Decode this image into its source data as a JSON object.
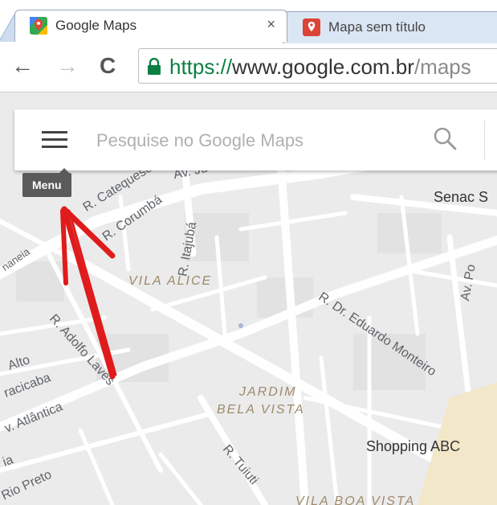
{
  "tabs": [
    {
      "title": "Google Maps",
      "close": "×"
    },
    {
      "title": "Mapa sem título"
    }
  ],
  "toolbar": {
    "back": "←",
    "forward": "→",
    "reload": "C",
    "url_scheme": "https://",
    "url_host": "www.google.com.br",
    "url_path": "/maps"
  },
  "search": {
    "placeholder": "Pesquise no Google Maps",
    "tooltip": "Menu"
  },
  "map": {
    "streets": {
      "catequese": "R. Catequese",
      "avju": "Av. Ju",
      "corumba": "R. Corumbá",
      "itajuba": "R. Itajubá",
      "eduardo": "R. Dr. Eduardo Monteiro",
      "adolfo": "R. Adolfo Laves",
      "alto": "Alto",
      "racicaba": "racicaba",
      "atlantica": "v. Atlântica",
      "tuiuti": "R. Tuiuti",
      "rioPreto": "Rio Preto",
      "ia": "ia",
      "naneia": "naneia",
      "avpo": "Av. Po"
    },
    "districts": {
      "vilaAlice": "VILA ALICE",
      "jardimLine1": "JARDIM",
      "jardimLine2": "BELA VISTA",
      "vilaBoaVista": "VILA BOA VISTA"
    },
    "pois": {
      "senac": "Senac S",
      "shopping": "Shopping ABC"
    }
  },
  "colors": {
    "arrow": "#e01b1b",
    "road": "#ffffff",
    "land": "#ebebeb"
  },
  "icons": [
    "maps-favicon",
    "pin-favicon",
    "lock-icon",
    "hamburger-menu-icon",
    "search-icon"
  ]
}
